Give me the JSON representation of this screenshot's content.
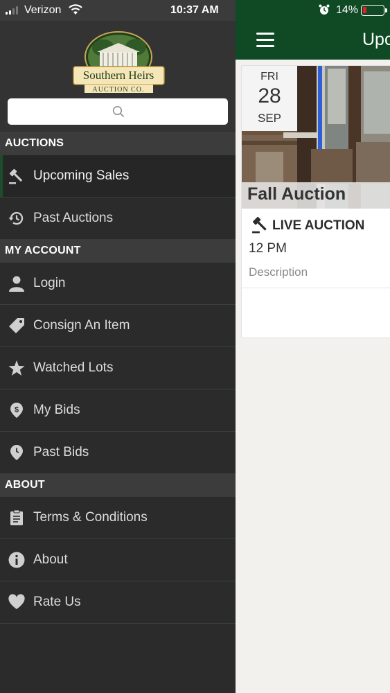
{
  "status_bar": {
    "carrier": "Verizon",
    "time": "10:37 AM",
    "battery": "14%"
  },
  "logo": {
    "line1": "Southern Heirs",
    "line2": "AUCTION CO."
  },
  "search": {
    "placeholder": ""
  },
  "sections": {
    "auctions": "AUCTIONS",
    "my_account": "MY ACCOUNT",
    "about": "ABOUT"
  },
  "menu": {
    "upcoming_sales": "Upcoming Sales",
    "past_auctions": "Past Auctions",
    "login": "Login",
    "consign": "Consign An Item",
    "watched_lots": "Watched Lots",
    "my_bids": "My Bids",
    "past_bids": "Past Bids",
    "terms": "Terms & Conditions",
    "about": "About",
    "rate_us": "Rate Us"
  },
  "appbar": {
    "title": "Upcoming Sales"
  },
  "card": {
    "dow": "FRI",
    "day": "28",
    "month": "SEP",
    "title": "Fall Auction",
    "type": "LIVE AUCTION",
    "time": "12 PM",
    "description": "Description"
  },
  "colors": {
    "brand_green": "#0f4a25",
    "drawer_bg": "#2b2b2b",
    "section_bg": "#3c3c3c"
  }
}
